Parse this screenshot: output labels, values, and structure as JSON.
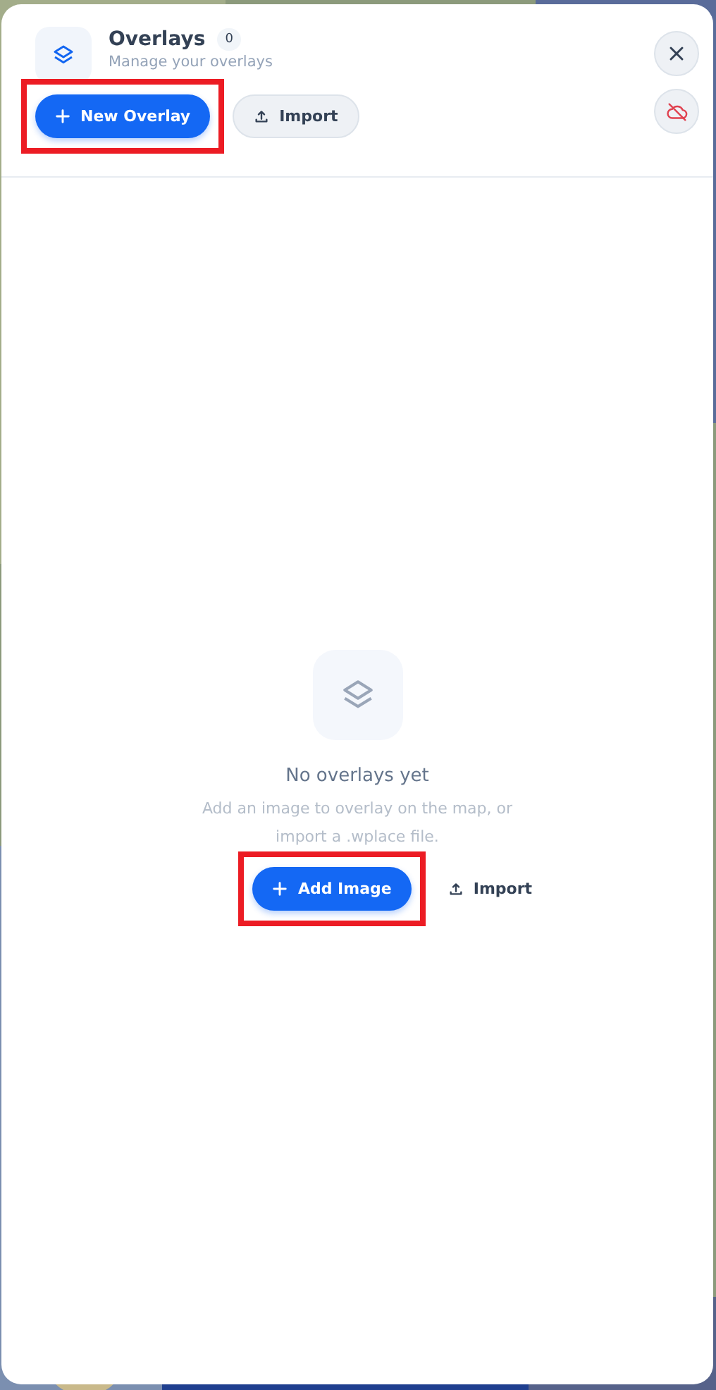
{
  "panel": {
    "title": "Overlays",
    "count": "0",
    "subtitle": "Manage your overlays"
  },
  "header_buttons": [
    {
      "kind": "primary",
      "label": "New Overlay",
      "highlighted": true
    },
    {
      "kind": "secondary",
      "label": "Import",
      "highlighted": false
    }
  ],
  "empty_state": {
    "title": "No overlays yet",
    "description": "Add an image to overlay on the map, or import a .wplace file.",
    "buttons": [
      {
        "kind": "primary",
        "label": "Add Image",
        "highlighted": true
      },
      {
        "kind": "link",
        "label": "Import",
        "highlighted": false
      }
    ]
  }
}
